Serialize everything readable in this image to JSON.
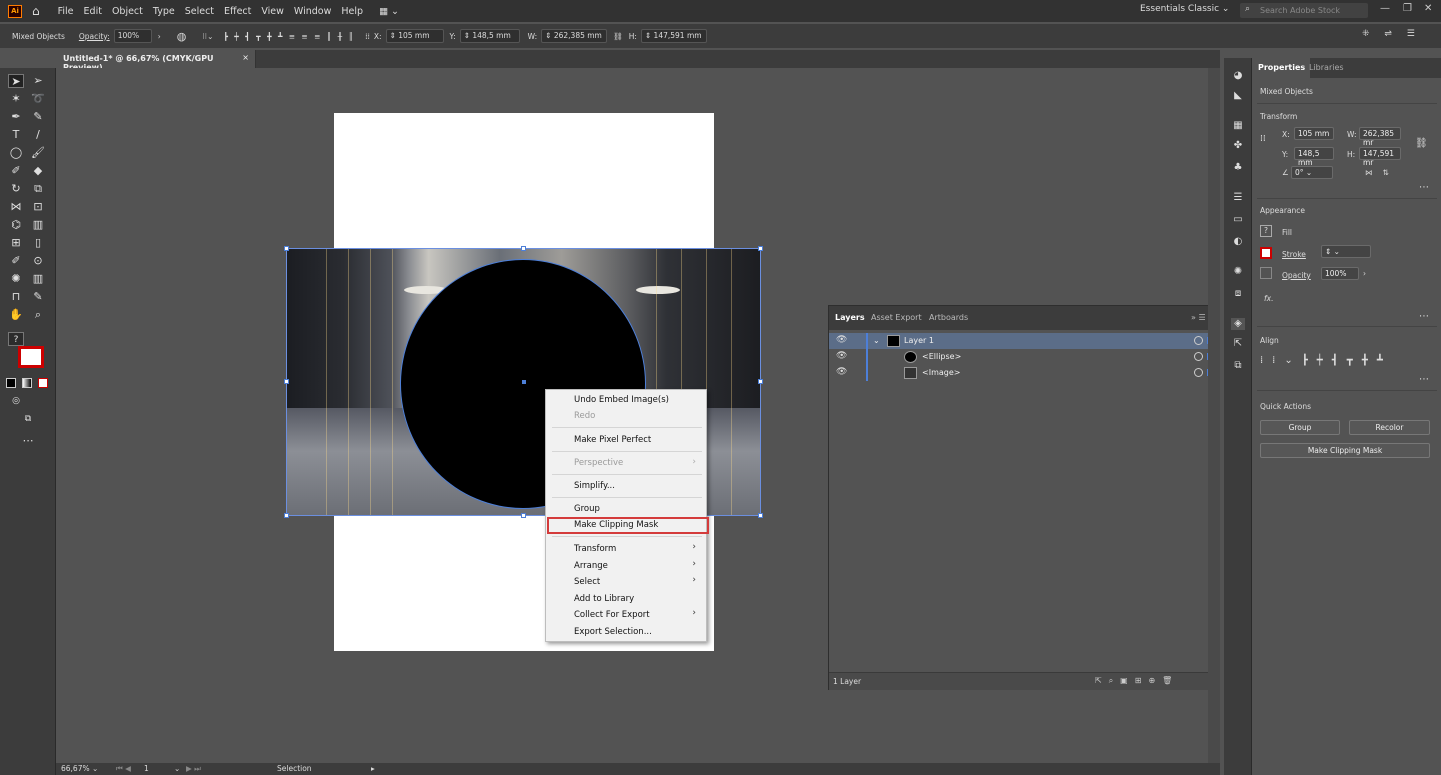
{
  "app": {
    "logo": "Ai",
    "workspace": "Essentials Classic",
    "search_placeholder": "Search Adobe Stock"
  },
  "menu": [
    "File",
    "Edit",
    "Object",
    "Type",
    "Select",
    "Effect",
    "View",
    "Window",
    "Help"
  ],
  "control_bar": {
    "selection_label": "Mixed Objects",
    "opacity_label": "Opacity:",
    "opacity_value": "100%",
    "x_label": "X:",
    "x_value": "105 mm",
    "y_label": "Y:",
    "y_value": "148,5 mm",
    "w_label": "W:",
    "w_value": "262,385 mm",
    "h_label": "H:",
    "h_value": "147,591 mm"
  },
  "document_tab": {
    "title": "Untitled-1* @ 66,67% (CMYK/GPU Preview)",
    "close": "×"
  },
  "context_menu": {
    "undo": "Undo Embed Image(s)",
    "redo": "Redo",
    "pixel_perfect": "Make Pixel Perfect",
    "perspective": "Perspective",
    "simplify": "Simplify...",
    "group": "Group",
    "clipping_mask": "Make Clipping Mask",
    "transform": "Transform",
    "arrange": "Arrange",
    "select": "Select",
    "add_library": "Add to Library",
    "collect_export": "Collect For Export",
    "export_selection": "Export Selection..."
  },
  "layers_panel": {
    "tabs": [
      "Layers",
      "Asset Export",
      "Artboards"
    ],
    "rows": [
      {
        "name": "Layer 1"
      },
      {
        "name": "<Ellipse>"
      },
      {
        "name": "<Image>"
      }
    ],
    "count": "1 Layer"
  },
  "properties": {
    "tabs": [
      "Properties",
      "Libraries"
    ],
    "selection": "Mixed Objects",
    "transform_title": "Transform",
    "x_label": "X:",
    "x_value": "105 mm",
    "y_label": "Y:",
    "y_value": "148,5 mm",
    "w_label": "W:",
    "w_value": "262,385 mr",
    "h_label": "H:",
    "h_value": "147,591 mr",
    "angle_value": "0°",
    "appearance_title": "Appearance",
    "fill_label": "Fill",
    "stroke_label": "Stroke",
    "opacity_label": "Opacity",
    "opacity_value": "100%",
    "fx": "fx.",
    "align_title": "Align",
    "quick_actions_title": "Quick Actions",
    "group_btn": "Group",
    "recolor_btn": "Recolor",
    "clip_btn": "Make Clipping Mask"
  },
  "statusbar": {
    "zoom": "66,67%",
    "artboard": "1",
    "tool": "Selection"
  },
  "colors": {
    "accent": "#4d7fd8",
    "highlight": "#d43b3b",
    "logo": "#ff7c00"
  }
}
